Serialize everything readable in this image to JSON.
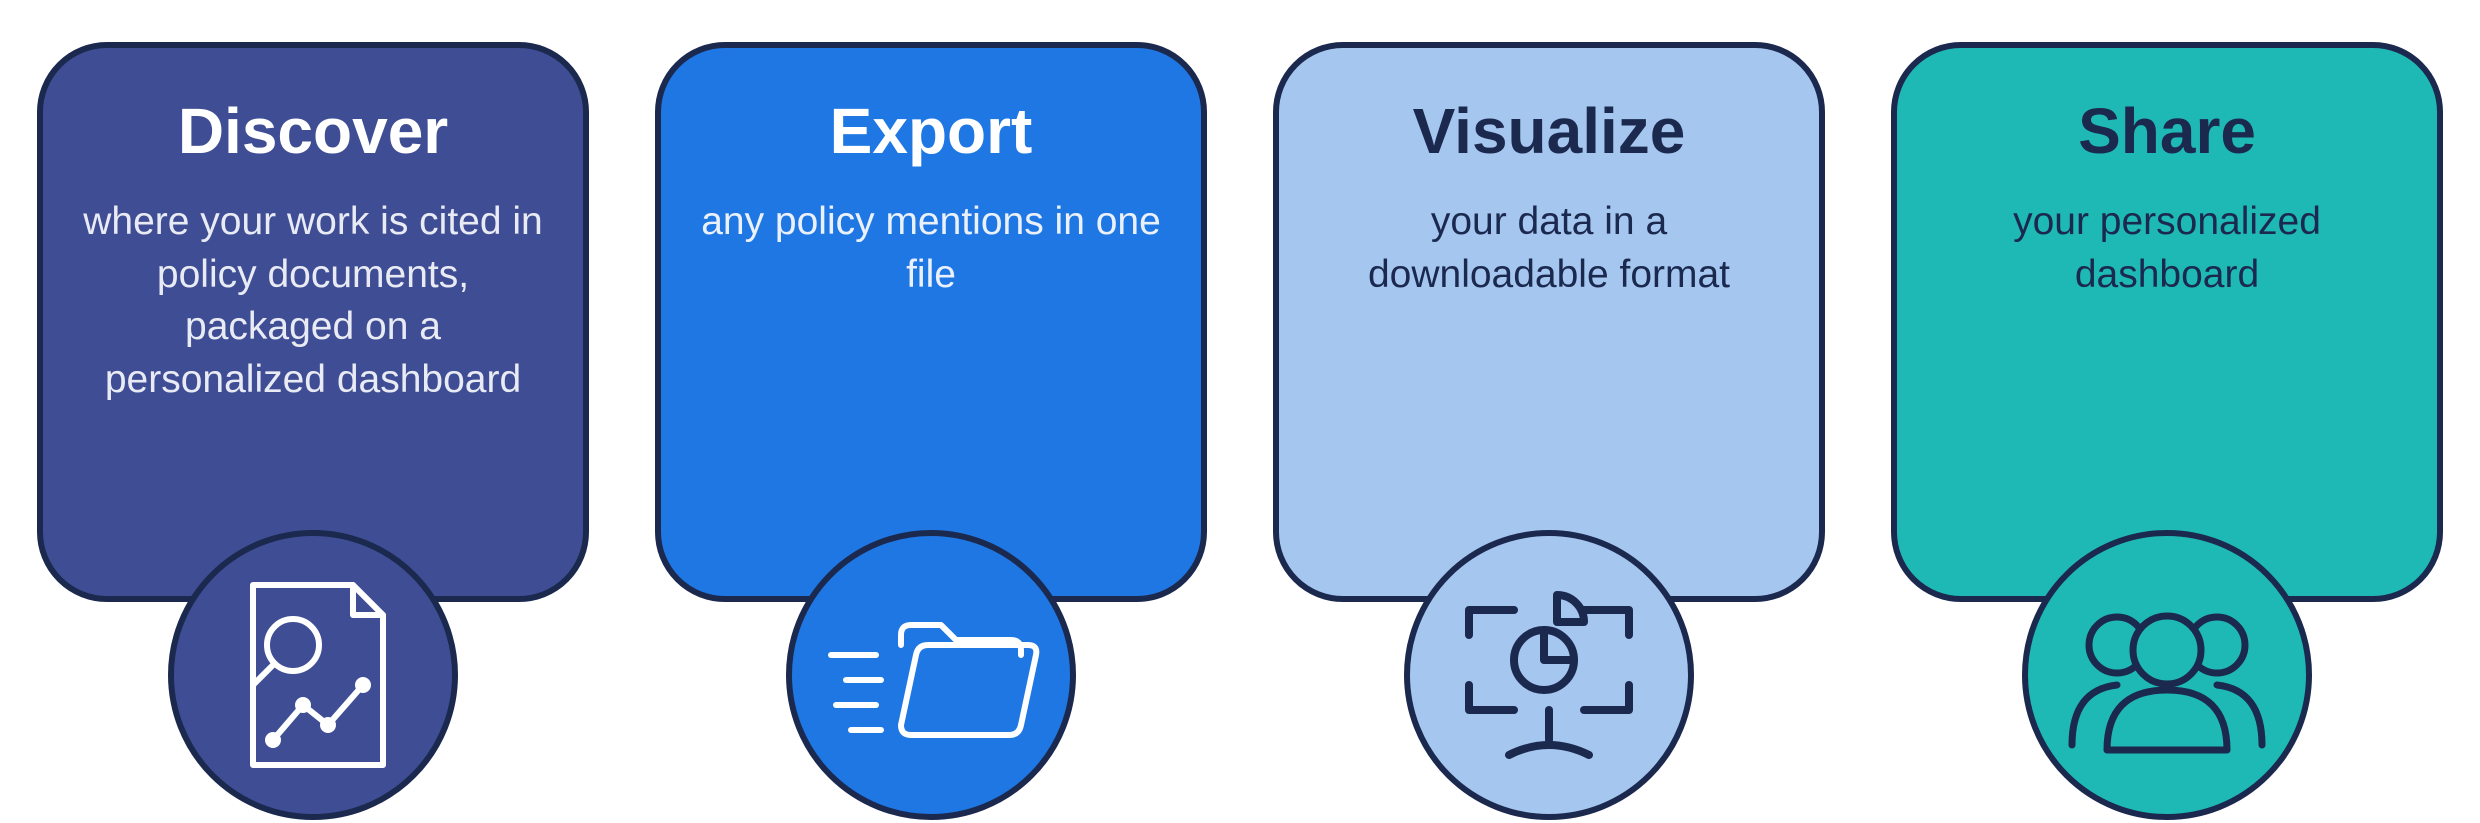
{
  "colors": {
    "outline": "#1b294f",
    "cards": {
      "discover": "#3f4e94",
      "export": "#1f77e4",
      "visualize": "#a5c6ef",
      "share": "#1fb9b5"
    }
  },
  "discover": {
    "title": "Discover",
    "body": "where your work is cited in policy documents, packaged on a personalized dashboard",
    "icon": "document-search-analytics-icon"
  },
  "export": {
    "title": "Export",
    "body": "any policy mentions in one file",
    "icon": "moving-folder-icon"
  },
  "visualize": {
    "title": "Visualize",
    "body": "your data in a downloadable format",
    "icon": "monitor-chart-icon"
  },
  "share": {
    "title": "Share",
    "body": "your personalized dashboard",
    "icon": "people-group-icon"
  }
}
